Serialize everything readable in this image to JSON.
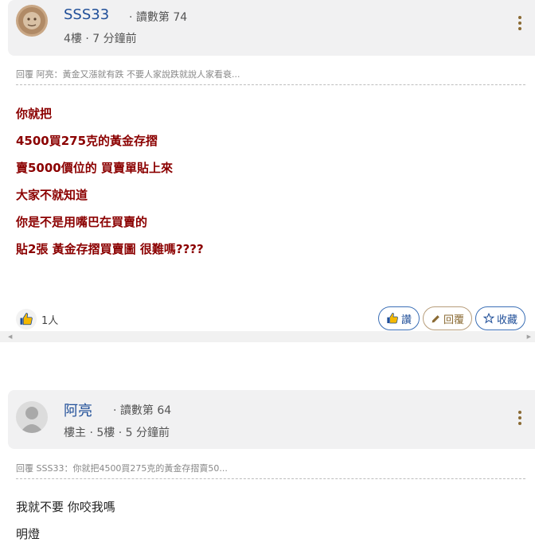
{
  "posts": [
    {
      "author": "SSS33",
      "score": "· 讀數第 74",
      "meta": "4樓 · 7 分鐘前",
      "reply_ref": "回覆 阿亮：黃金又漲就有跌 不要人家說跌就說人家看衰...",
      "lines": [
        "你就把",
        "4500買275克的黃金存摺",
        "賣5000價位的 買賣單貼上來",
        "大家不就知道",
        "你是不是用嘴巴在買賣的",
        "貼2張 黃金存摺買賣圖 很難嗎????"
      ],
      "like_count": "1人",
      "buttons": {
        "like": "讚",
        "reply": "回覆",
        "save": "收藏"
      }
    },
    {
      "author": "阿亮",
      "score": "· 讀數第 64",
      "meta": "樓主 · 5樓 · 5 分鐘前",
      "reply_ref": "回覆 SSS33：你就把4500買275克的黃金存摺賣50...",
      "lines": [
        "我就不要 你咬我嗎",
        "明燈"
      ]
    }
  ],
  "icons": {
    "kebab": "more-vertical-icon",
    "like": "thumbs-up-icon",
    "reply": "pencil-icon",
    "save": "star-outline-icon"
  },
  "colors": {
    "author": "#1f4e98",
    "post_text_emphasis": "#8b0000",
    "header_bg": "#f1f1f2",
    "kebab": "#8a6a33"
  }
}
